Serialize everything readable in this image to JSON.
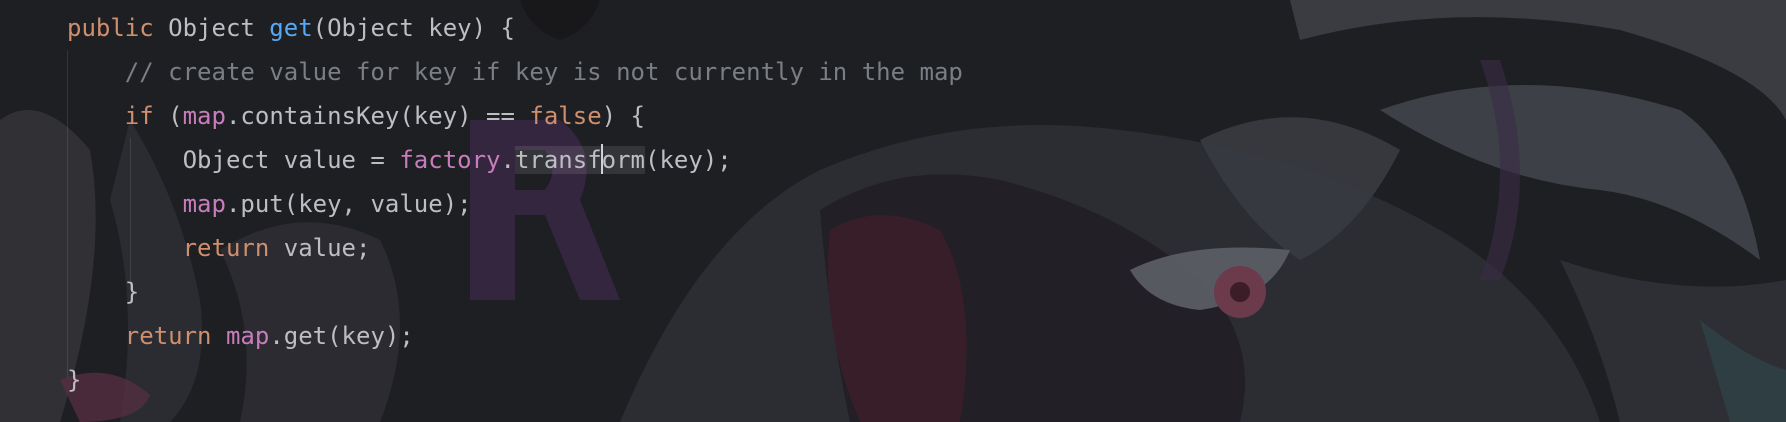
{
  "editor": {
    "language": "Java",
    "colors": {
      "background": "#1e1f22",
      "keyword": "#cf8e6d",
      "method_declaration": "#56a8f5",
      "field": "#c77dbb",
      "comment": "#7a7e85",
      "text": "#bcbec4"
    },
    "lines": [
      [
        {
          "type": "kw",
          "text": "public"
        },
        {
          "type": "plain",
          "text": " Object "
        },
        {
          "type": "fn",
          "text": "get"
        },
        {
          "type": "plain",
          "text": "(Object key) {"
        }
      ],
      [
        {
          "type": "plain",
          "text": "    "
        },
        {
          "type": "comment",
          "text": "// create value for key if key is not currently in the map"
        }
      ],
      [
        {
          "type": "plain",
          "text": "    "
        },
        {
          "type": "kw",
          "text": "if"
        },
        {
          "type": "plain",
          "text": " ("
        },
        {
          "type": "field",
          "text": "map"
        },
        {
          "type": "plain",
          "text": ".containsKey(key) == "
        },
        {
          "type": "kw",
          "text": "false"
        },
        {
          "type": "plain",
          "text": ") {"
        }
      ],
      [
        {
          "type": "plain",
          "text": "        Object value = "
        },
        {
          "type": "field",
          "text": "factory"
        },
        {
          "type": "plain",
          "text": "."
        },
        {
          "type": "hl",
          "text": "transf"
        },
        {
          "type": "caret",
          "text": ""
        },
        {
          "type": "hl",
          "text": "orm"
        },
        {
          "type": "plain",
          "text": "(key);"
        }
      ],
      [
        {
          "type": "plain",
          "text": "        "
        },
        {
          "type": "field",
          "text": "map"
        },
        {
          "type": "plain",
          "text": ".put(key, value);"
        }
      ],
      [
        {
          "type": "plain",
          "text": "        "
        },
        {
          "type": "kw",
          "text": "return"
        },
        {
          "type": "plain",
          "text": " value;"
        }
      ],
      [
        {
          "type": "plain",
          "text": "    }"
        }
      ],
      [
        {
          "type": "plain",
          "text": "    "
        },
        {
          "type": "kw",
          "text": "return"
        },
        {
          "type": "plain",
          "text": " "
        },
        {
          "type": "field",
          "text": "map"
        },
        {
          "type": "plain",
          "text": ".get(key);"
        }
      ],
      [
        {
          "type": "plain",
          "text": "}"
        }
      ]
    ]
  }
}
